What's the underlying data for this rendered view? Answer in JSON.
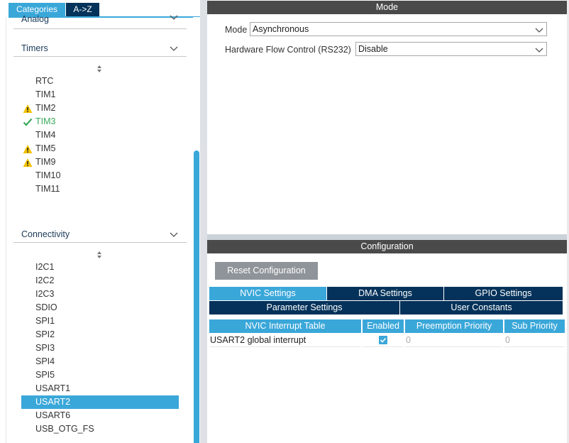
{
  "tabs": {
    "categories": "Categories",
    "az": "A->Z"
  },
  "sections": {
    "analog": {
      "label": "Analog"
    },
    "timers": {
      "label": "Timers",
      "items": [
        {
          "label": "RTC",
          "status": "none"
        },
        {
          "label": "TIM1",
          "status": "none"
        },
        {
          "label": "TIM2",
          "status": "warning"
        },
        {
          "label": "TIM3",
          "status": "ok"
        },
        {
          "label": "TIM4",
          "status": "none"
        },
        {
          "label": "TIM5",
          "status": "warning"
        },
        {
          "label": "TIM9",
          "status": "warning"
        },
        {
          "label": "TIM10",
          "status": "none"
        },
        {
          "label": "TIM11",
          "status": "none"
        }
      ]
    },
    "connectivity": {
      "label": "Connectivity",
      "items": [
        {
          "label": "I2C1"
        },
        {
          "label": "I2C2"
        },
        {
          "label": "I2C3"
        },
        {
          "label": "SDIO"
        },
        {
          "label": "SPI1"
        },
        {
          "label": "SPI2"
        },
        {
          "label": "SPI3"
        },
        {
          "label": "SPI4"
        },
        {
          "label": "SPI5"
        },
        {
          "label": "USART1"
        },
        {
          "label": "USART2",
          "selected": true
        },
        {
          "label": "USART6"
        },
        {
          "label": "USB_OTG_FS"
        }
      ]
    }
  },
  "mode": {
    "title": "Mode",
    "mode_label": "Mode",
    "mode_value": "Asynchronous",
    "flow_label": "Hardware Flow Control (RS232)",
    "flow_value": "Disable"
  },
  "configuration": {
    "title": "Configuration",
    "reset_label": "Reset Configuration",
    "tabs_row1": [
      "NVIC Settings",
      "DMA Settings",
      "GPIO Settings"
    ],
    "tabs_row2": [
      "Parameter Settings",
      "User Constants"
    ],
    "table": {
      "headers": [
        "NVIC Interrupt Table",
        "Enabled",
        "Preemption Priority",
        "Sub Priority"
      ],
      "rows": [
        {
          "name": "USART2 global interrupt",
          "enabled": true,
          "preemption": "0",
          "sub": "0"
        }
      ]
    }
  },
  "colors": {
    "accent": "#3aa7d9",
    "dark_navy": "#04325a",
    "header_gray": "#4a4a4a",
    "ok_green": "#3aa85a",
    "warning_yellow": "#f2c200"
  }
}
